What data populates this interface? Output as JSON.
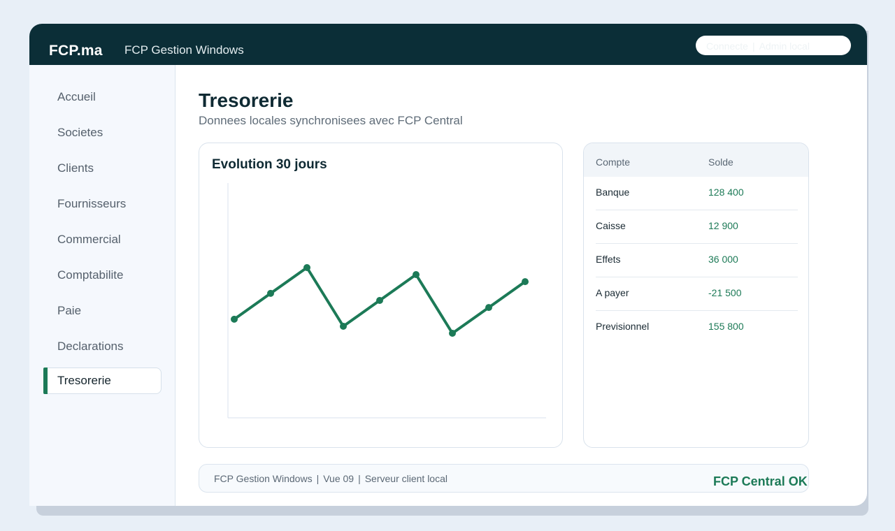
{
  "header": {
    "brand": "FCP.ma",
    "app_title": "FCP Gestion Windows",
    "status": {
      "connection": "Connecte",
      "user": "Admin local"
    }
  },
  "sidebar": {
    "items": [
      {
        "label": "Accueil",
        "active": false
      },
      {
        "label": "Societes",
        "active": false
      },
      {
        "label": "Clients",
        "active": false
      },
      {
        "label": "Fournisseurs",
        "active": false
      },
      {
        "label": "Commercial",
        "active": false
      },
      {
        "label": "Comptabilite",
        "active": false
      },
      {
        "label": "Paie",
        "active": false
      },
      {
        "label": "Declarations",
        "active": false
      },
      {
        "label": "Tresorerie",
        "active": true
      }
    ]
  },
  "main": {
    "title": "Tresorerie",
    "subtitle": "Donnees locales synchronisees avec FCP Central"
  },
  "chart_data": {
    "type": "line",
    "title": "Evolution 30 jours",
    "xlabel": "",
    "ylabel": "",
    "x": [
      1,
      2,
      3,
      4,
      5,
      6,
      7,
      8,
      9
    ],
    "series": [
      {
        "values": [
          42,
          53,
          64,
          39,
          50,
          61,
          36,
          47,
          58
        ]
      }
    ],
    "ylim": [
      0,
      100
    ],
    "grid": false,
    "color": "#1c7a57"
  },
  "table": {
    "headers": {
      "account": "Compte",
      "balance": "Solde"
    },
    "rows": [
      {
        "account": "Banque",
        "balance": "128 400"
      },
      {
        "account": "Caisse",
        "balance": "12 900"
      },
      {
        "account": "Effets",
        "balance": "36 000"
      },
      {
        "account": "A payer",
        "balance": "-21 500"
      },
      {
        "account": "Previsionnel",
        "balance": "155 800"
      }
    ]
  },
  "footer": {
    "app": "FCP Gestion Windows",
    "view": "Vue 09",
    "server": "Serveur client local",
    "central_status": "FCP Central OK"
  },
  "colors": {
    "titlebar": "#0b2e37",
    "accent": "#1c7a57",
    "background": "#e8eff7"
  }
}
